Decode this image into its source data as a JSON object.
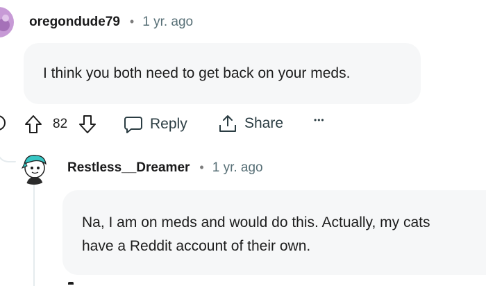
{
  "comment": {
    "username": "oregondude79",
    "separator": "•",
    "time": "1 yr. ago",
    "body": "I think you both need to get back on your meds.",
    "votes": "82",
    "reply_label": "Reply",
    "share_label": "Share",
    "more_label": "•••"
  },
  "reply": {
    "username": "Restless__Dreamer",
    "separator": "•",
    "time": "1 yr. ago",
    "body_line1": "Na, I am on meds and would do this. Actually, my cats",
    "body_line2": "have a Reddit account of their own."
  },
  "colors": {
    "bubble_bg": "#f6f7f8",
    "text": "#1c1c1c",
    "muted": "#576f76",
    "avatar1_bg": "#c79ad6",
    "avatar2_accent": "#37c6c4"
  }
}
